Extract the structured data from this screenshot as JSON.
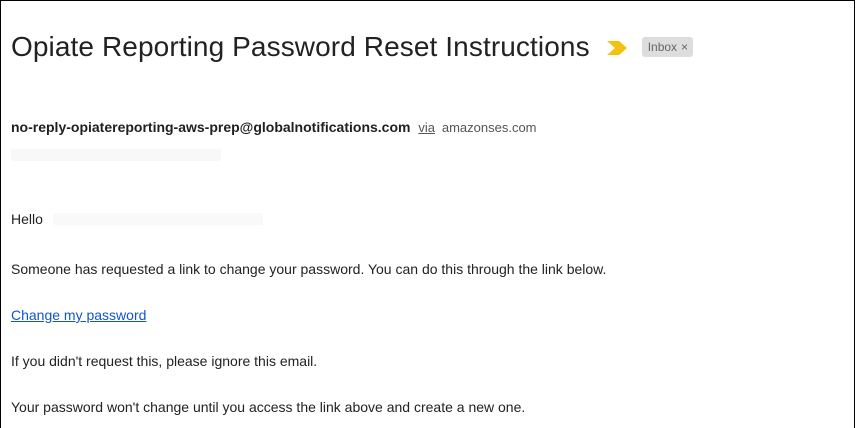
{
  "email": {
    "subject": "Opiate Reporting Password Reset Instructions",
    "label": "Inbox",
    "label_close": "×",
    "sender": "no-reply-opiatereporting-aws-prep@globalnotifications.com",
    "via_text": "via",
    "via_domain": "amazonses.com",
    "colors": {
      "importance_marker": "#f4c20d",
      "link": "#1155cc",
      "chip_bg": "#dddddd"
    },
    "body": {
      "greeting": "Hello",
      "paragraph1": "Someone has requested a link to change your password. You can do this through the link below.",
      "link_text": "Change my password",
      "paragraph2": "If you didn't request this, please ignore this email.",
      "paragraph3": "Your password won't change until you access the link above and create a new one."
    }
  }
}
